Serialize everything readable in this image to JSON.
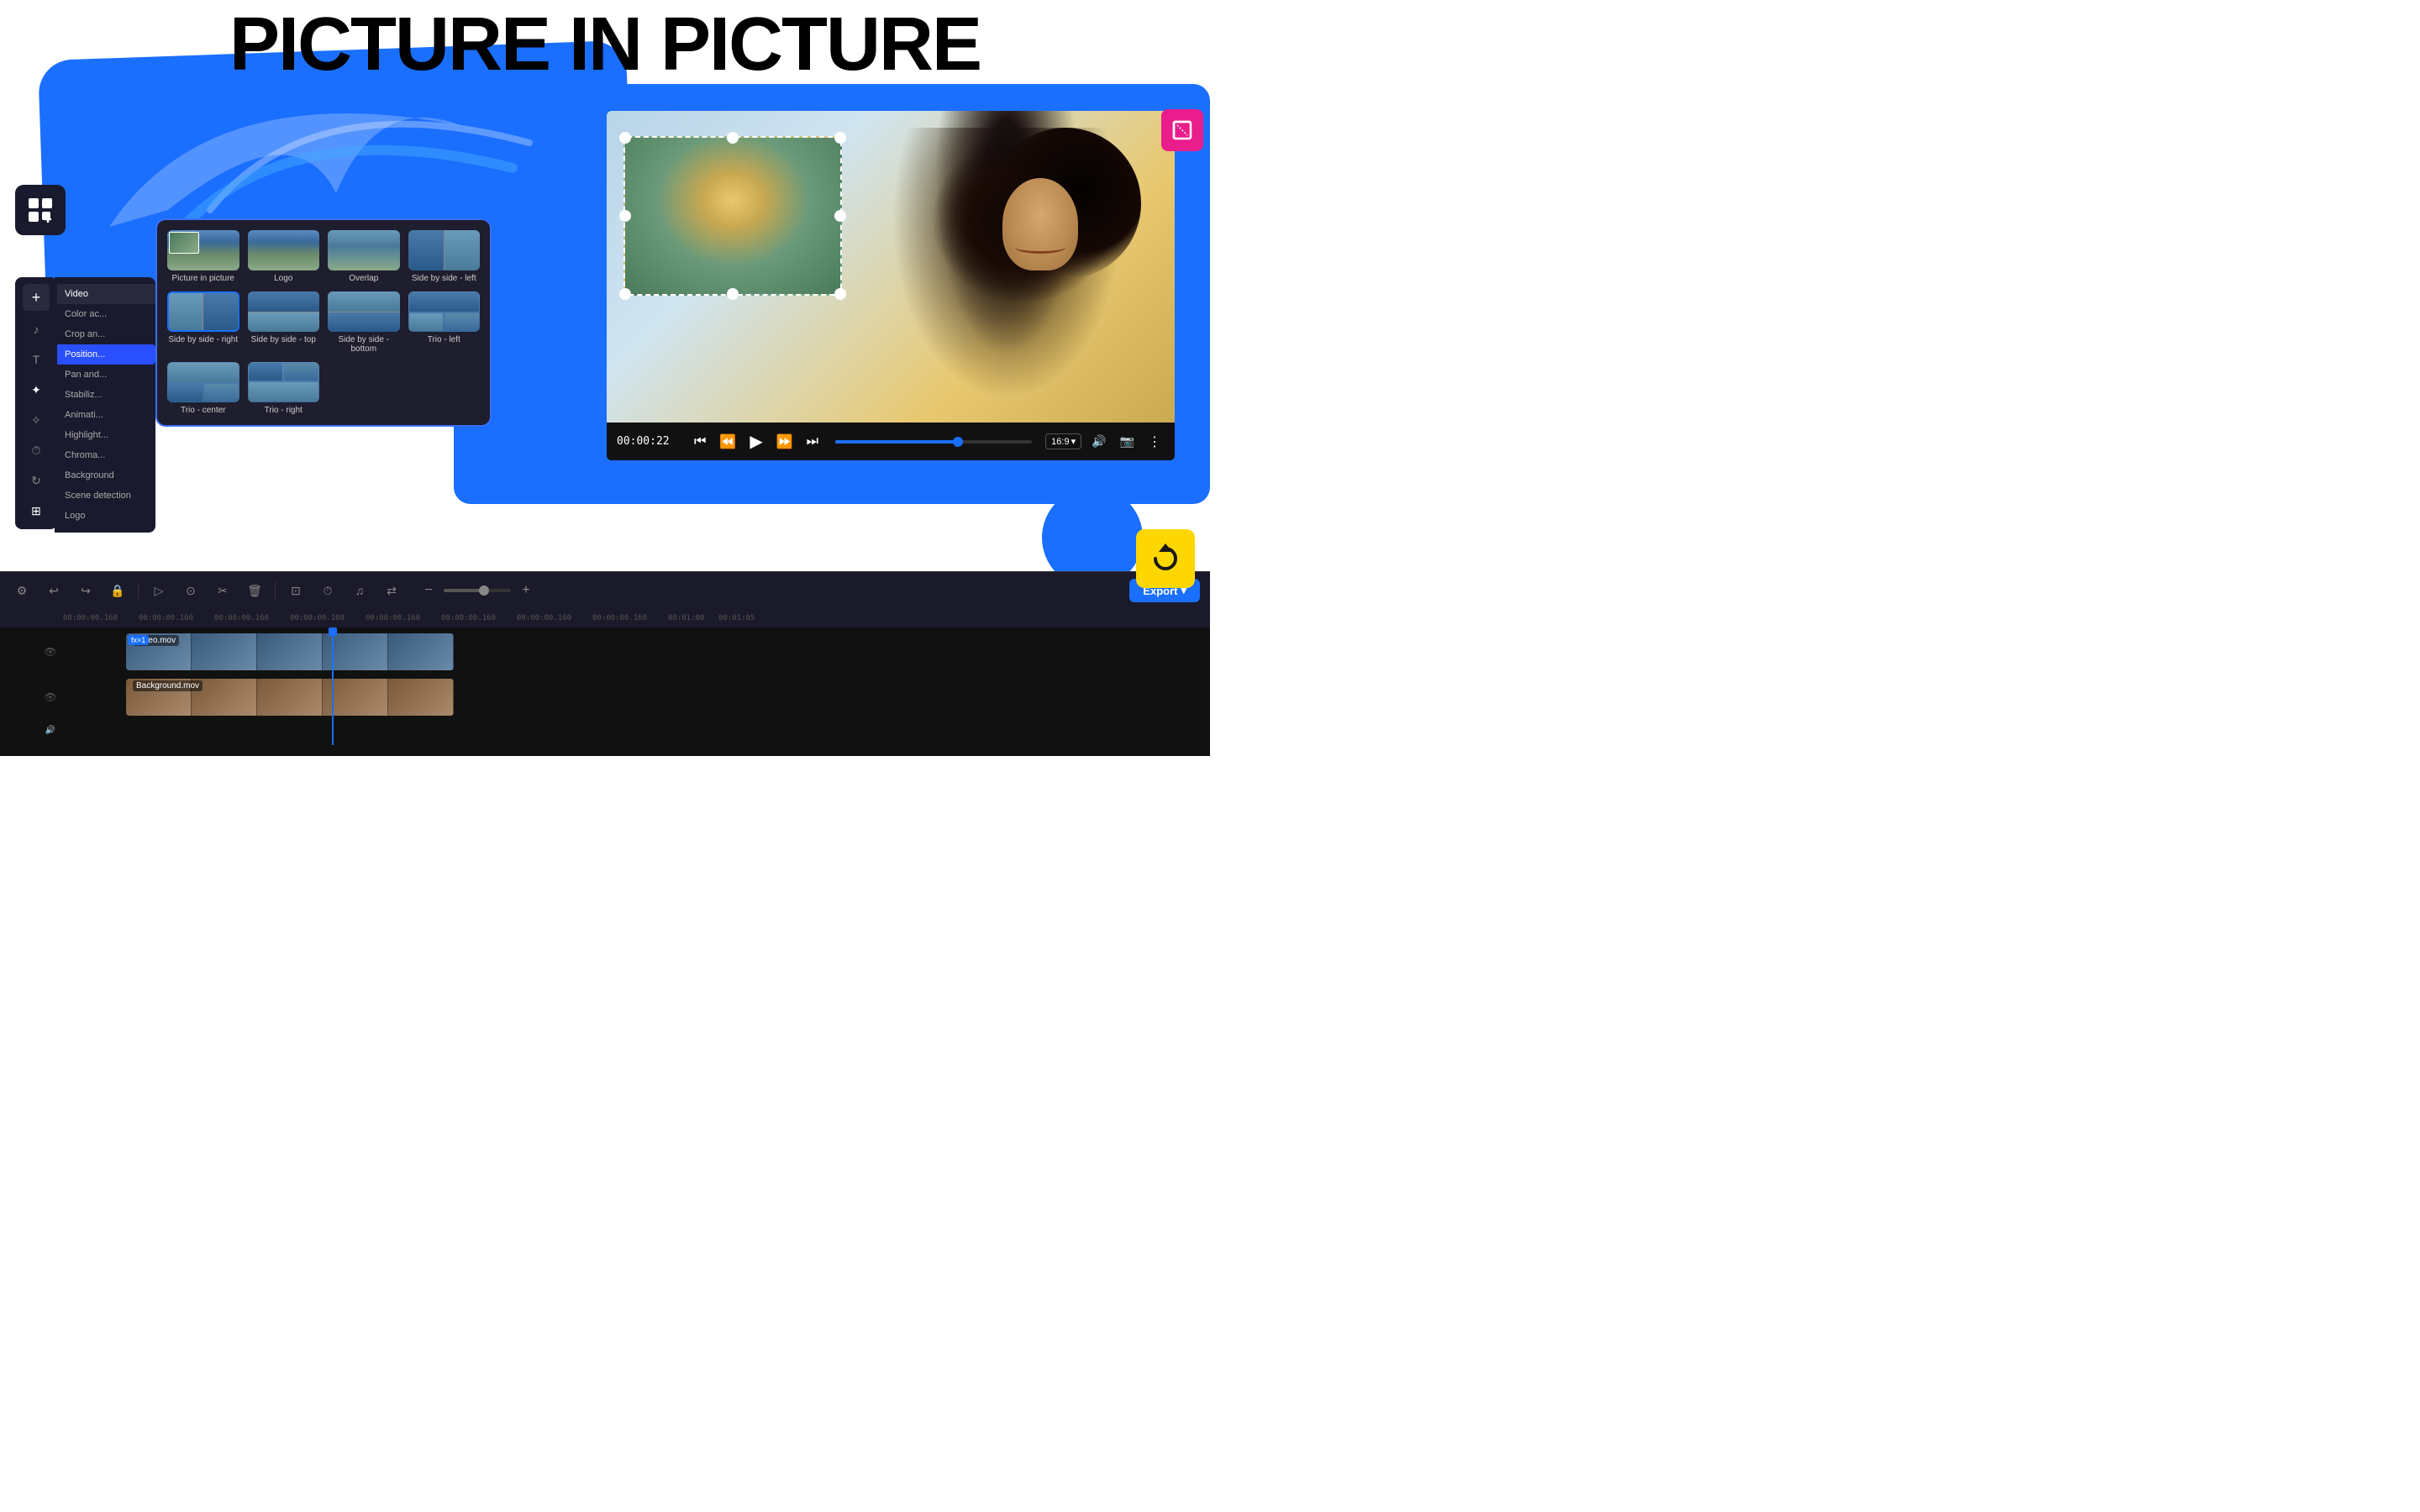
{
  "title": "PICTURE IN PICTURE",
  "decorative": {
    "blue_bg": true,
    "crop_icon": "✂",
    "refresh_icon": "↺"
  },
  "grid_icon": {
    "label": "apps-icon"
  },
  "effects_panel": {
    "tabs": [
      "Video",
      "Color ac",
      "Crop an",
      "Position",
      "Pan and",
      "Stabiliz",
      "Animati",
      "Highlight",
      "Chroma",
      "Background",
      "Scene detection",
      "Logo"
    ],
    "active_tab": "Video",
    "effects": [
      {
        "id": "pip",
        "label": "Picture in picture",
        "type": "pip"
      },
      {
        "id": "logo",
        "label": "Logo",
        "type": "mountain"
      },
      {
        "id": "overlap",
        "label": "Overlap",
        "type": "mountain"
      },
      {
        "id": "sbs-left",
        "label": "Side by side - left",
        "type": "mountain"
      },
      {
        "id": "sbs-right",
        "label": "Side by side - right",
        "type": "mountain",
        "selected": true
      },
      {
        "id": "sbs-top",
        "label": "Side by side - top",
        "type": "mountain"
      },
      {
        "id": "sbs-bottom",
        "label": "Side by side - bottom",
        "type": "mountain"
      },
      {
        "id": "trio-left",
        "label": "Trio - left",
        "type": "mountain"
      },
      {
        "id": "trio-center",
        "label": "Trio - center",
        "type": "mountain"
      },
      {
        "id": "trio-right",
        "label": "Trio - right",
        "type": "mountain"
      }
    ]
  },
  "video_player": {
    "time": "00:00:22",
    "aspect_ratio": "16:9",
    "pip_visible": true
  },
  "timeline": {
    "tracks": [
      {
        "id": "video-track",
        "label": "Video.mov",
        "fx_badge": "fx×1",
        "type": "blue"
      },
      {
        "id": "bg-track",
        "label": "Background.mov",
        "type": "warm"
      }
    ],
    "time_marks": [
      "00:00:00.160",
      "00:00:00.160",
      "00:00:00.160",
      "00:00:00.160",
      "00:00:00.160",
      "00:00:00.160",
      "00:00:00.160",
      "00:00:00.160",
      "00:00:01:00",
      "00:01:05"
    ]
  },
  "toolbar": {
    "export_label": "Export",
    "export_arrow": "▾"
  }
}
